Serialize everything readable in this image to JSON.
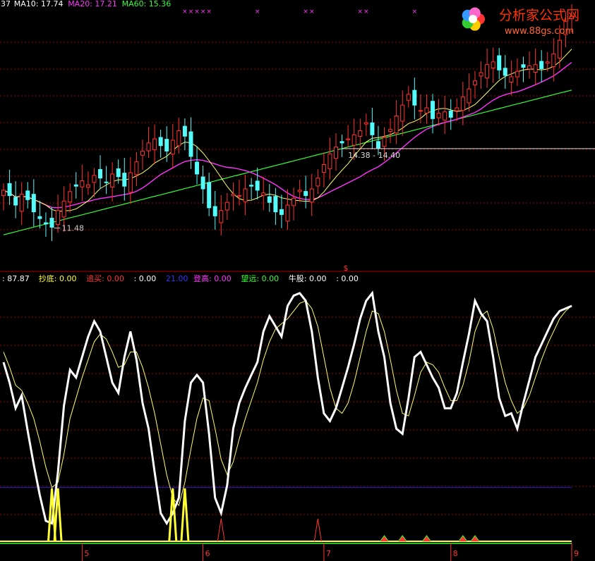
{
  "top_legend": [
    {
      "text": "37",
      "color": "#ffffff"
    },
    {
      "text": "MA10: 17.74",
      "color": "#ffffff"
    },
    {
      "text": "MA20: 17.21",
      "color": "#ff33ff"
    },
    {
      "text": "MA60: 15.36",
      "color": "#33ff33"
    }
  ],
  "ind_legend": [
    {
      "text": ": 87.87",
      "color": "#ffffff"
    },
    {
      "text": "抄底: 0.00",
      "color": "#ffff33"
    },
    {
      "text": "追买: 0.00",
      "color": "#ff3333"
    },
    {
      "text": ": 0.00",
      "color": "#ffffff"
    },
    {
      "text": "21.00",
      "color": "#3333ff"
    },
    {
      "text": "登高: 0.00",
      "color": "#ff33ff"
    },
    {
      "text": "望远: 0.00",
      "color": "#33ff33"
    },
    {
      "text": "牛股: 0.00",
      "color": "#ffffff"
    },
    {
      "text": ": 0.00",
      "color": "#ffffff"
    }
  ],
  "logo": {
    "title": "分析家公式网",
    "url": "www.88gs.com"
  },
  "dollar_marker": "$",
  "annotations": {
    "low": "11.48",
    "range": "14.38 - 14.40"
  },
  "colors": {
    "up": "#ff3232",
    "down": "#54fcfc",
    "grid": "#a00000",
    "k": "#ffffff",
    "d": "#ffff66",
    "ma10": "#ffff66",
    "ma20": "#ff33ff",
    "ma60": "#33ff33",
    "level": "#2222cc"
  },
  "chart_data": [
    {
      "type": "candlestick",
      "title": "",
      "x_tick_labels": [
        "5",
        "6",
        "7",
        "8",
        "9"
      ],
      "reference_level": 14.39,
      "ylim": [
        10.5,
        19.5
      ],
      "close": [
        12.85,
        12.65,
        12.3,
        12.7,
        12.5,
        12.05,
        11.8,
        11.6,
        11.48,
        12.1,
        12.45,
        12.8,
        13.0,
        13.2,
        13.05,
        13.4,
        13.3,
        13.15,
        13.45,
        13.35,
        13.0,
        13.5,
        13.9,
        14.3,
        14.6,
        14.75,
        14.5,
        14.3,
        14.7,
        15.05,
        14.85,
        14.1,
        13.45,
        12.9,
        12.2,
        11.9,
        12.1,
        12.4,
        12.7,
        12.65,
        12.9,
        13.0,
        12.85,
        12.75,
        12.4,
        12.05,
        11.95,
        12.3,
        12.55,
        12.85,
        12.65,
        12.9,
        13.3,
        13.8,
        14.2,
        14.45,
        14.6,
        14.75,
        14.9,
        15.05,
        15.35,
        14.9,
        14.4,
        14.8,
        15.1,
        15.6,
        16.0,
        16.4,
        16.0,
        15.8,
        15.9,
        15.5,
        15.7,
        15.75,
        15.55,
        15.9,
        16.3,
        16.6,
        16.9,
        17.2,
        17.5,
        17.6,
        17.3,
        17.1,
        17.05,
        17.25,
        17.4,
        17.45,
        17.5,
        17.35,
        17.6,
        17.9,
        18.4,
        19.1,
        19.3
      ]
    },
    {
      "type": "line",
      "title": "",
      "x_tick_labels": [
        "5",
        "6",
        "7",
        "8",
        "9"
      ],
      "ylim": [
        0,
        100
      ],
      "level": 21.0,
      "series": [
        {
          "values": [
            70,
            62,
            52,
            57,
            43,
            30,
            18,
            8,
            7,
            27,
            53,
            67,
            64,
            72,
            80,
            86,
            82,
            72,
            62,
            58,
            72,
            82,
            71,
            54,
            44,
            27,
            11,
            7,
            11,
            17,
            47,
            62,
            65,
            62,
            42,
            17,
            11,
            22,
            44,
            54,
            60,
            65,
            70,
            82,
            88,
            84,
            80,
            92,
            96,
            97,
            94,
            82,
            64,
            50,
            47,
            52,
            60,
            68,
            77,
            87,
            94,
            97,
            82,
            72,
            54,
            44,
            42,
            56,
            72,
            74,
            69,
            64,
            60,
            52,
            52,
            58,
            70,
            81,
            94,
            89,
            86,
            72,
            56,
            49,
            50,
            44,
            54,
            63,
            72,
            77,
            82,
            87,
            90,
            91,
            92
          ]
        },
        {
          "values": [
            74,
            68,
            61,
            59,
            54,
            48,
            39,
            29,
            21,
            23,
            34,
            48,
            56,
            64,
            71,
            78,
            81,
            79,
            74,
            68,
            69,
            74,
            74,
            68,
            60,
            50,
            38,
            26,
            17,
            14,
            23,
            36,
            48,
            56,
            55,
            44,
            32,
            26,
            31,
            40,
            48,
            55,
            62,
            71,
            78,
            83,
            85,
            87,
            90,
            93,
            94,
            91,
            84,
            72,
            60,
            52,
            50,
            54,
            62,
            72,
            82,
            90,
            89,
            82,
            71,
            59,
            50,
            49,
            57,
            66,
            70,
            69,
            66,
            60,
            55,
            55,
            61,
            70,
            82,
            88,
            90,
            83,
            72,
            62,
            55,
            50,
            52,
            57,
            64,
            71,
            77,
            82,
            87,
            90,
            92
          ]
        }
      ],
      "signals": {
        "抄底": [
          8,
          9,
          28,
          30
        ],
        "追买": [
          36,
          52
        ],
        "登高": [
          63,
          66,
          70,
          76,
          78
        ]
      }
    }
  ]
}
